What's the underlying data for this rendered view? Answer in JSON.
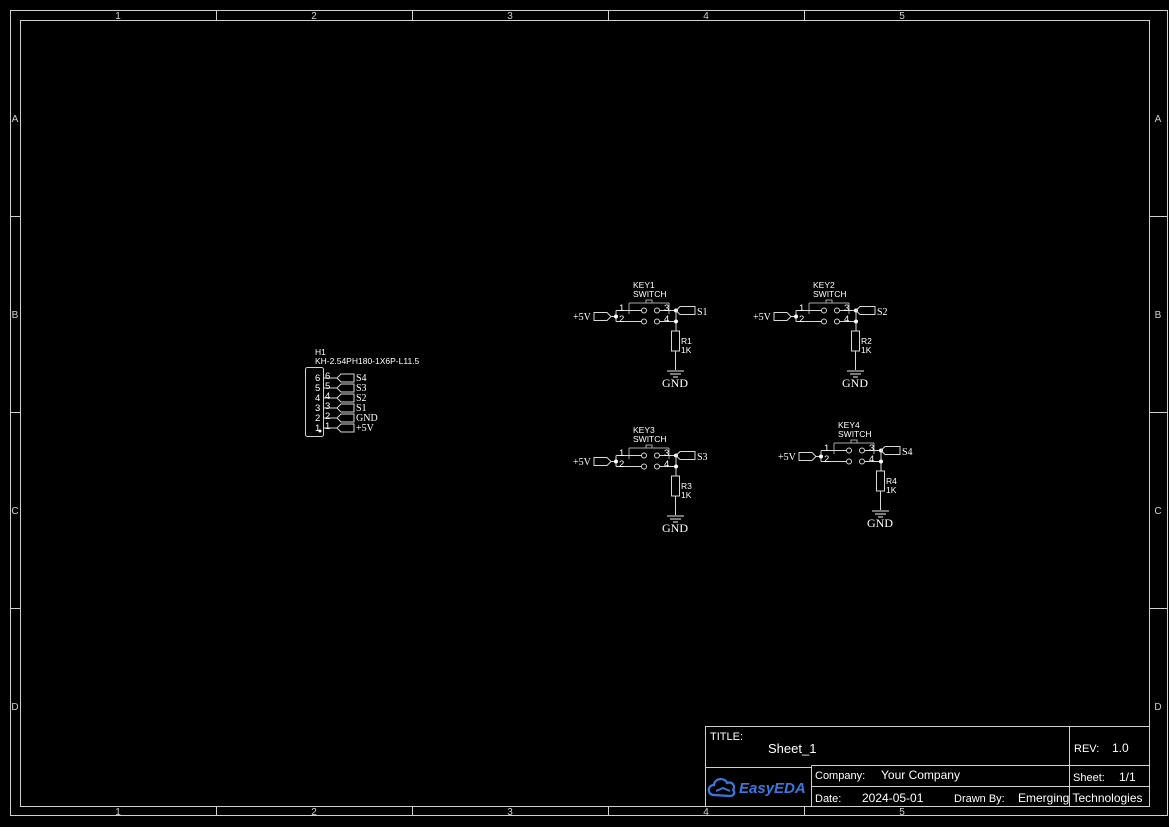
{
  "frame": {
    "columns": [
      "1",
      "2",
      "3",
      "4",
      "5"
    ],
    "rows": [
      "A",
      "B",
      "C",
      "D"
    ]
  },
  "connector": {
    "designator": "H1",
    "part": "KH-2.54PH180-1X6P-L11.5",
    "pins": [
      {
        "num": "6",
        "net": "S4"
      },
      {
        "num": "5",
        "net": "S3"
      },
      {
        "num": "4",
        "net": "S2"
      },
      {
        "num": "3",
        "net": "S1"
      },
      {
        "num": "2",
        "net": "GND"
      },
      {
        "num": "1",
        "net": "+5V"
      }
    ]
  },
  "keys": [
    {
      "designator": "KEY1",
      "type": "SWITCH",
      "input_net": "+5V",
      "output_net": "S1",
      "resistor": "R1",
      "value": "1K",
      "ground": "GND"
    },
    {
      "designator": "KEY2",
      "type": "SWITCH",
      "input_net": "+5V",
      "output_net": "S2",
      "resistor": "R2",
      "value": "1K",
      "ground": "GND"
    },
    {
      "designator": "KEY3",
      "type": "SWITCH",
      "input_net": "+5V",
      "output_net": "S3",
      "resistor": "R3",
      "value": "1K",
      "ground": "GND"
    },
    {
      "designator": "KEY4",
      "type": "SWITCH",
      "input_net": "+5V",
      "output_net": "S4",
      "resistor": "R4",
      "value": "1K",
      "ground": "GND"
    }
  ],
  "switch_pins": [
    "1",
    "2",
    "3",
    "4"
  ],
  "title_block": {
    "title_label": "TITLE:",
    "title": "Sheet_1",
    "rev_label": "REV:",
    "rev": "1.0",
    "company_label": "Company:",
    "company": "Your Company",
    "sheet_label": "Sheet:",
    "sheet": "1/1",
    "date_label": "Date:",
    "date": "2024-05-01",
    "drawn_label": "Drawn By:",
    "drawn_by": "Emerging Technologies",
    "logo": "EasyEDA",
    "logo_icon": "cloud-icon",
    "logo_color": "#3a78e0"
  },
  "colors": {
    "background": "#000000",
    "lines": "#d0d0d0",
    "junction": "#ffffff",
    "ground_symbol": "#9a9a9a"
  }
}
